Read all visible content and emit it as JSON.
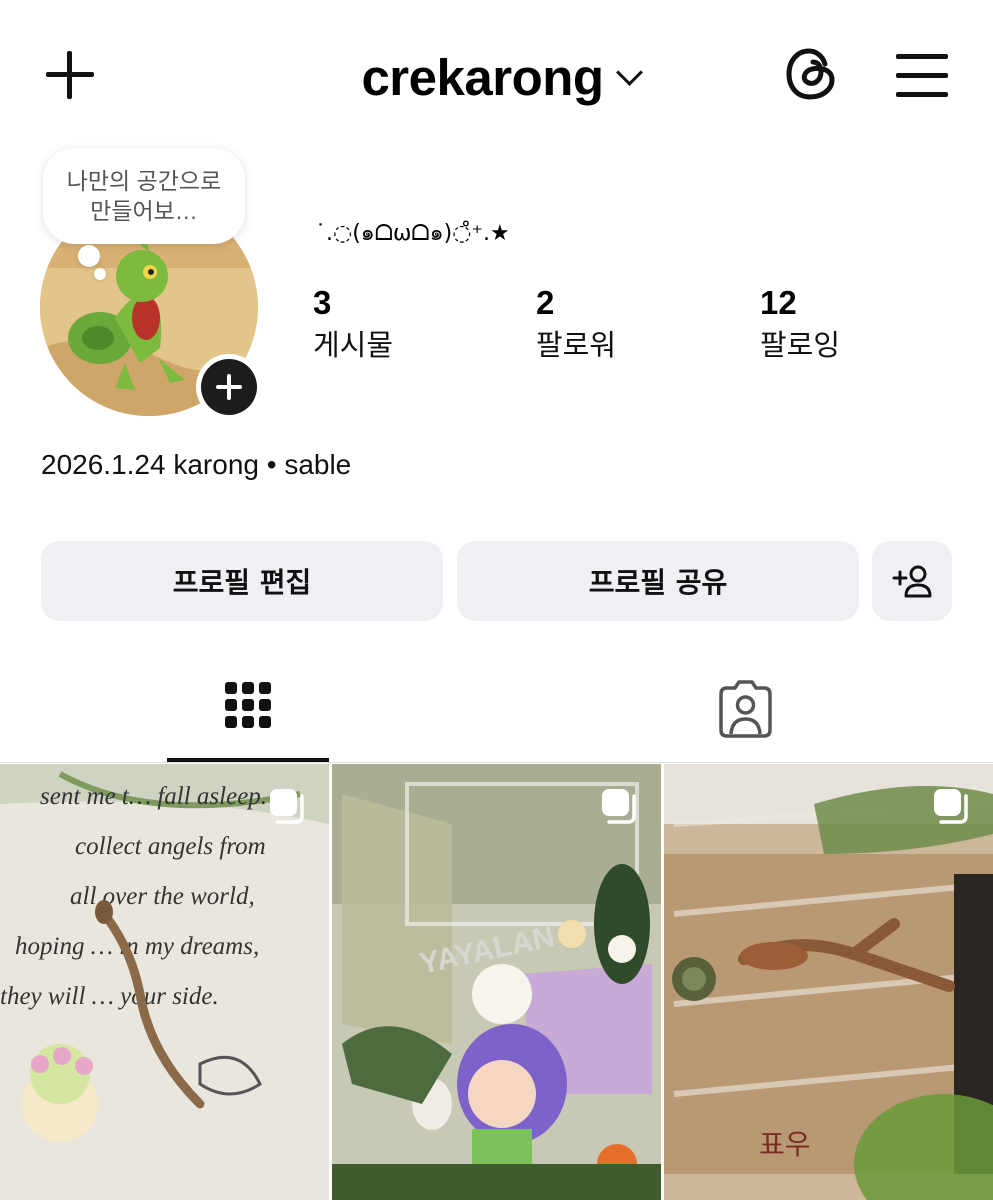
{
  "header": {
    "username": "crekarong",
    "add_icon": "plus-icon",
    "threads_icon": "threads-icon",
    "menu_icon": "hamburger-menu-icon"
  },
  "profile": {
    "note": "나만의 공간으로 만들어보…",
    "display_name": "˙.◌(๑ᗝωᗝ๑)◌̊⁺.★",
    "stats": [
      {
        "count": "3",
        "label": "게시물"
      },
      {
        "count": "2",
        "label": "팔로워"
      },
      {
        "count": "12",
        "label": "팔로잉"
      }
    ],
    "bio": "2026.1.24 karong • sable"
  },
  "actions": {
    "edit_label": "프로필 편집",
    "share_label": "프로필 공유",
    "suggest_icon": "add-person-icon"
  },
  "tabs": [
    {
      "name": "posts-grid",
      "icon": "grid-icon",
      "active": true
    },
    {
      "name": "tagged",
      "icon": "tagged-person-icon",
      "active": false
    }
  ],
  "posts": [
    {
      "type": "carousel",
      "icon": "multiple-posts-icon",
      "caption_text": [
        "sent me t… fall asleep.",
        "collect angels from",
        "all over the world,",
        "hoping … in my dreams,",
        "they will … your side."
      ]
    },
    {
      "type": "carousel",
      "icon": "multiple-posts-icon",
      "sign_text": "YAYALAN"
    },
    {
      "type": "carousel",
      "icon": "multiple-posts-icon",
      "label_text": "표우"
    }
  ],
  "colors": {
    "button_bg": "#eef0f3",
    "text": "#000000",
    "divider": "#dbdbdb"
  }
}
